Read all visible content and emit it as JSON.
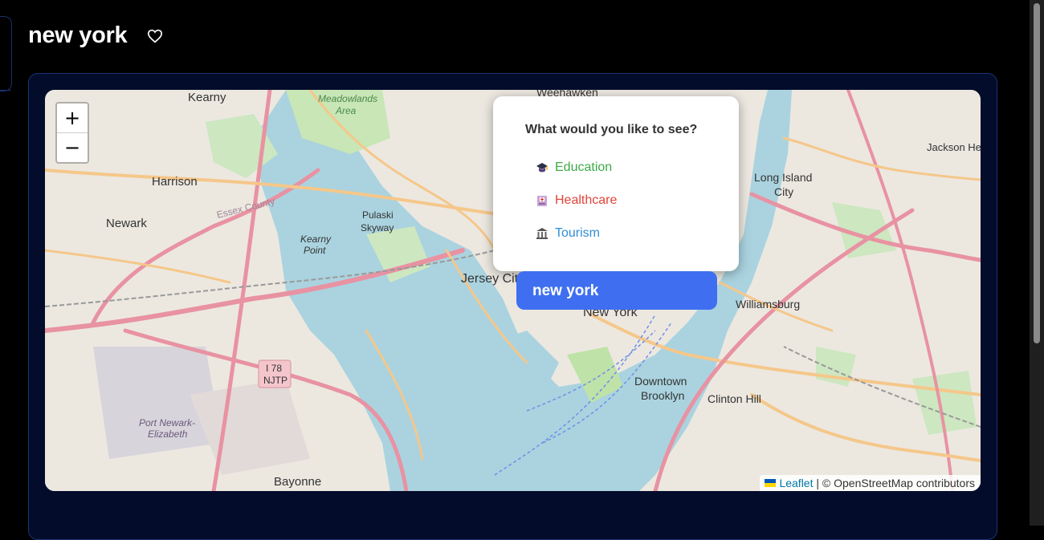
{
  "page": {
    "title": "new york"
  },
  "map": {
    "zoom_in": "+",
    "zoom_out": "−",
    "marker_label": "new york",
    "popup": {
      "question": "What would you like to see?",
      "options": [
        {
          "label": "Education",
          "icon": "graduation-cap-icon",
          "color": "#3daa47"
        },
        {
          "label": "Healthcare",
          "icon": "hospital-icon",
          "color": "#e0443a"
        },
        {
          "label": "Tourism",
          "icon": "landmark-icon",
          "color": "#2f8fd6"
        }
      ]
    },
    "attribution": {
      "leaflet": "Leaflet",
      "separator": " | © OpenStreetMap contributors"
    },
    "place_labels": [
      "Kearny",
      "Harrison",
      "Newark",
      "Pulaski Skyway",
      "Kearny Point",
      "Jersey City",
      "New York",
      "Weehawken",
      "Long Island City",
      "Williamsburg",
      "Downtown Brooklyn",
      "Clinton Hill",
      "Bayonne",
      "Port Newark-Elizabeth",
      "Jackson He",
      "Meadowlands Area",
      "Essex County",
      "I 78 NJTP"
    ]
  },
  "colors": {
    "accent": "#3f6ff0",
    "panel_bg": "#030c2b",
    "panel_border": "#1c3272"
  }
}
